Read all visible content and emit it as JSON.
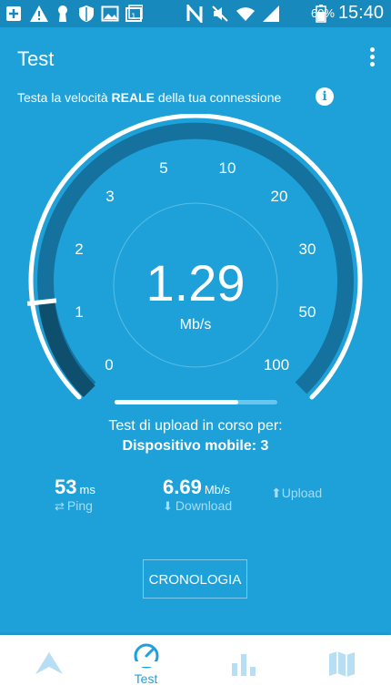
{
  "status_bar": {
    "battery_percent": "60%",
    "clock": "15:40",
    "icons": [
      "add-box-icon",
      "warning-icon",
      "keyhole-icon",
      "shield-icon",
      "image-icon",
      "calendar-1-icon",
      "nfc-icon",
      "mute-icon",
      "wifi-icon",
      "signal-icon",
      "battery-icon"
    ]
  },
  "app_bar": {
    "title": "Test",
    "overflow_icon": "more-vert-icon"
  },
  "subtitle": {
    "prefix": "Testa la velocità ",
    "bold": "REALE",
    "suffix": " della tua connessione",
    "info_icon": "info-icon",
    "info_glyph": "i"
  },
  "gauge": {
    "value": "1.29",
    "unit": "Mb/s",
    "scale_labels": [
      "0",
      "1",
      "2",
      "3",
      "5",
      "10",
      "20",
      "30",
      "50",
      "100"
    ],
    "current_value_mbps": 1.29
  },
  "progress": {
    "fraction": 0.76
  },
  "upload_status": {
    "line1": "Test di upload in corso per:",
    "line2": "Dispositivo mobile: 3"
  },
  "stats": {
    "ping": {
      "value": "53",
      "unit": "ms",
      "label": "Ping",
      "icon": "swap-icon"
    },
    "download": {
      "value": "6.69",
      "unit": "Mb/s",
      "label": "Download",
      "icon": "arrow-down-icon"
    },
    "upload": {
      "label": "Upload",
      "icon": "arrow-up-icon"
    }
  },
  "history_button": {
    "label": "CRONOLOGIA"
  },
  "bottom_nav": {
    "items": [
      {
        "icon": "navigation-arrow-icon",
        "label": ""
      },
      {
        "icon": "speedometer-icon",
        "label": "Test",
        "active": true
      },
      {
        "icon": "bar-chart-icon",
        "label": ""
      },
      {
        "icon": "map-icon",
        "label": ""
      }
    ]
  },
  "colors": {
    "background": "#1ea1d9",
    "status_bar": "#1789bc",
    "dark_ring": "#15729e",
    "active_arc": "#0e4f6e",
    "light_text": "#a9dbf2",
    "nav_inactive": "#b7def2"
  }
}
